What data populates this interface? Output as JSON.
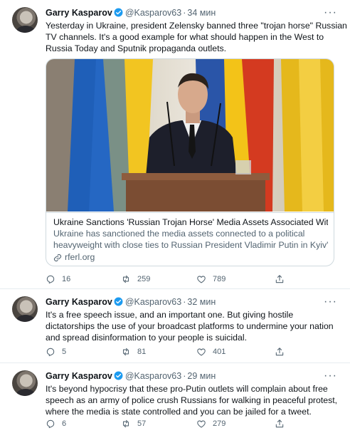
{
  "tweets": [
    {
      "name": "Garry Kasparov",
      "handle": "@Kasparov63",
      "sep": "·",
      "time": "34 мин",
      "lines": [
        "Yesterday in Ukraine, president Zelensky banned three \"trojan horse\" Russian",
        "TV channels. It's a good example for what should happen in the West to",
        "Russia Today and Sputnik propaganda outlets."
      ],
      "card": {
        "title": "Ukraine Sanctions 'Russian Trojan Horse' Media Assets Associated With ...",
        "desc": [
          "Ukraine has sanctioned the media assets connected to a political",
          "heavyweight with close ties to Russian President Vladimir Putin in Kyiv's ..."
        ],
        "domain": "rferl.org"
      },
      "reply_count": "16",
      "retweet_count": "259",
      "like_count": "789"
    },
    {
      "name": "Garry Kasparov",
      "handle": "@Kasparov63",
      "sep": "·",
      "time": "32 мин",
      "lines": [
        "It's a free speech issue, and an important one. But giving hostile",
        "dictatorships the use of your broadcast platforms to undermine your nation",
        "and spread disinformation to your people is suicidal."
      ],
      "reply_count": "5",
      "retweet_count": "81",
      "like_count": "401"
    },
    {
      "name": "Garry Kasparov",
      "handle": "@Kasparov63",
      "sep": "·",
      "time": "29 мин",
      "lines": [
        "It's beyond hypocrisy that these pro-Putin outlets will complain about free",
        "speech as an army of police crush Russians for walking in peaceful protest,",
        "where the media is state controlled and you can be jailed for a tweet."
      ],
      "reply_count": "6",
      "retweet_count": "57",
      "like_count": "279"
    }
  ],
  "colors": {
    "text": "#0f1419",
    "secondary": "#536471",
    "verified": "#1d9bf0",
    "border": "#e6ecf0"
  },
  "icons": [
    "verified-badge-icon",
    "more-icon",
    "reply-icon",
    "retweet-icon",
    "like-icon",
    "share-icon",
    "link-icon"
  ]
}
